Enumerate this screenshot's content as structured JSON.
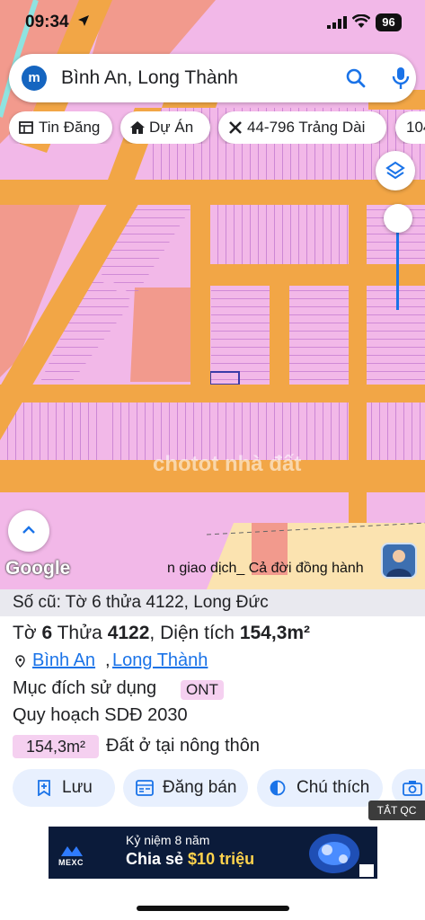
{
  "status_bar": {
    "time": "09:34",
    "battery": "96"
  },
  "search": {
    "value": "Bình An, Long Thành",
    "logo_letter": "m"
  },
  "chips": [
    {
      "label": "Tin Đăng",
      "icon": "newspaper-icon"
    },
    {
      "label": "Dự Án",
      "icon": "house-icon"
    },
    {
      "label": "44-796 Trảng Dài",
      "icon": "cross-tools-icon"
    },
    {
      "label": "104",
      "icon": ""
    }
  ],
  "map": {
    "google_label": "Google",
    "watermark": "chotot nhà đất",
    "marquee_text": "n giao dịch_ Cả đời đồng hành",
    "colors": {
      "residential": "#f2b8e8",
      "road": "#f2a646",
      "commercial": "#f29a8d",
      "plan_line": "#c47ad1"
    }
  },
  "parcel": {
    "old_info": "Số cũ: Tờ 6 thửa 4122, Long Đức",
    "to_label": "Tờ",
    "to_value": "6",
    "thua_label": "Thửa",
    "thua_value": "4122",
    "area_label": "Diện tích",
    "area_value": "154,3m²",
    "ward": "Bình An",
    "district": "Long Thành",
    "purpose_label": "Mục đích sử dụng",
    "purpose_code": "ONT",
    "plan_label": "Quy hoạch SDĐ 2030",
    "plan_area": "154,3m²",
    "plan_type": "Đất ở tại nông thôn"
  },
  "actions": [
    {
      "label": "Lưu",
      "icon": "bookmark-add-icon"
    },
    {
      "label": "Đăng bán",
      "icon": "listing-icon"
    },
    {
      "label": "Chú thích",
      "icon": "contrast-icon"
    },
    {
      "label": "",
      "icon": "camera-icon"
    }
  ],
  "ad": {
    "close_label": "TẮT QC",
    "brand": "MEXC",
    "line1": "Kỷ niệm 8 năm",
    "line2_prefix": "Chia sẻ",
    "line2_highlight": "$10 triệu"
  }
}
